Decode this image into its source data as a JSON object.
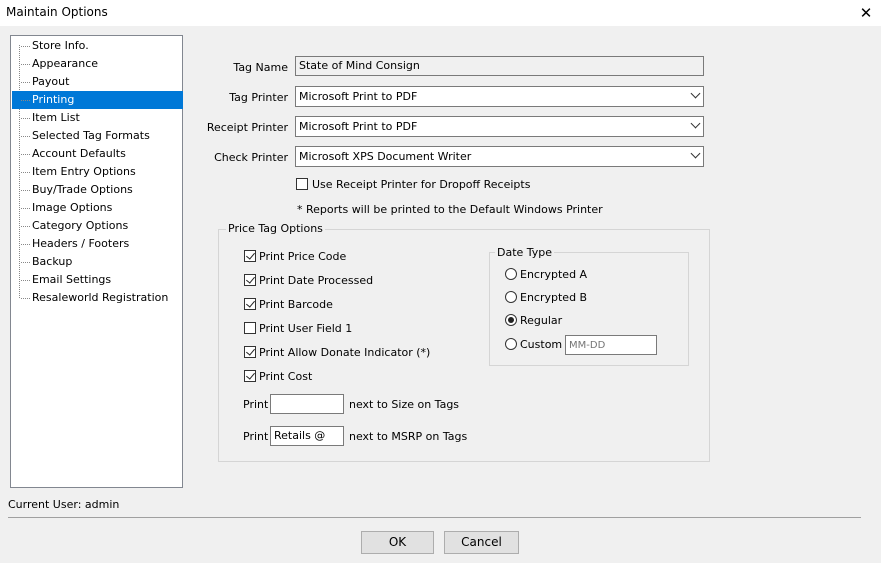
{
  "window": {
    "title": "Maintain Options",
    "close_glyph": "✕"
  },
  "sidebar": {
    "items": [
      {
        "label": "Store Info."
      },
      {
        "label": "Appearance"
      },
      {
        "label": "Payout"
      },
      {
        "label": "Printing"
      },
      {
        "label": "Item List"
      },
      {
        "label": "Selected Tag Formats"
      },
      {
        "label": "Account Defaults"
      },
      {
        "label": "Item Entry Options"
      },
      {
        "label": "Buy/Trade Options"
      },
      {
        "label": "Image Options"
      },
      {
        "label": "Category Options"
      },
      {
        "label": "Headers / Footers"
      },
      {
        "label": "Backup"
      },
      {
        "label": "Email Settings"
      },
      {
        "label": "Resaleworld Registration"
      }
    ],
    "selected": "Printing",
    "selection_color": "#0078d7"
  },
  "printing": {
    "tag_name_label": "Tag Name",
    "tag_name_value": "State of Mind Consign",
    "tag_printer_label": "Tag Printer",
    "tag_printer_value": "Microsoft Print to PDF",
    "receipt_printer_label": "Receipt Printer",
    "receipt_printer_value": "Microsoft Print to PDF",
    "check_printer_label": "Check Printer",
    "check_printer_value": "Microsoft XPS Document Writer",
    "use_receipt_label": "Use Receipt Printer for Dropoff Receipts",
    "use_receipt_checked": false,
    "note": "* Reports will be printed to the Default Windows Printer"
  },
  "price_tag_options": {
    "group_label": "Price Tag Options",
    "checkboxes": [
      {
        "label": "Print Price Code",
        "checked": true
      },
      {
        "label": "Print Date Processed",
        "checked": true
      },
      {
        "label": "Print Barcode",
        "checked": true
      },
      {
        "label": "Print User Field 1",
        "checked": false
      },
      {
        "label": "Print Allow Donate Indicator (*)",
        "checked": true
      },
      {
        "label": "Print Cost",
        "checked": true
      }
    ],
    "size_row": {
      "prefix": "Print",
      "value": "",
      "suffix": "next to Size on Tags"
    },
    "msrp_row": {
      "prefix": "Print",
      "value": "Retails @",
      "suffix": "next to MSRP on Tags"
    }
  },
  "date_type": {
    "group_label": "Date Type",
    "options": [
      {
        "label": "Encrypted A",
        "selected": false
      },
      {
        "label": "Encrypted B",
        "selected": false
      },
      {
        "label": "Regular",
        "selected": true
      },
      {
        "label": "Custom",
        "selected": false
      }
    ],
    "custom_placeholder": "MM-DD"
  },
  "status": {
    "current_user": "Current User: admin"
  },
  "buttons": {
    "ok": "OK",
    "cancel": "Cancel"
  }
}
